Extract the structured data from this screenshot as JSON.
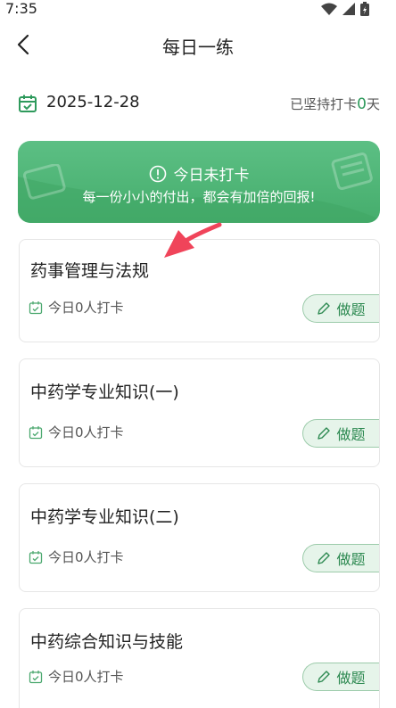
{
  "status_bar": {
    "time": "7:35"
  },
  "nav": {
    "title": "每日一练"
  },
  "date_row": {
    "date": "2025-12-28",
    "streak_prefix": "已坚持打卡",
    "streak_count": "0",
    "streak_suffix": "天"
  },
  "banner": {
    "status": "今日未打卡",
    "slogan": "每一份小小的付出，都会有加倍的回报!"
  },
  "courses": [
    {
      "title": "药事管理与法规",
      "checkin": "今日0人打卡",
      "action": "做题"
    },
    {
      "title": "中药学专业知识(一)",
      "checkin": "今日0人打卡",
      "action": "做题"
    },
    {
      "title": "中药学专业知识(二)",
      "checkin": "今日0人打卡",
      "action": "做题"
    },
    {
      "title": "中药综合知识与技能",
      "checkin": "今日0人打卡",
      "action": "做题"
    }
  ],
  "colors": {
    "accent": "#2e9a5c",
    "banner": "#4fb574",
    "annotation_arrow": "#f0445a"
  }
}
